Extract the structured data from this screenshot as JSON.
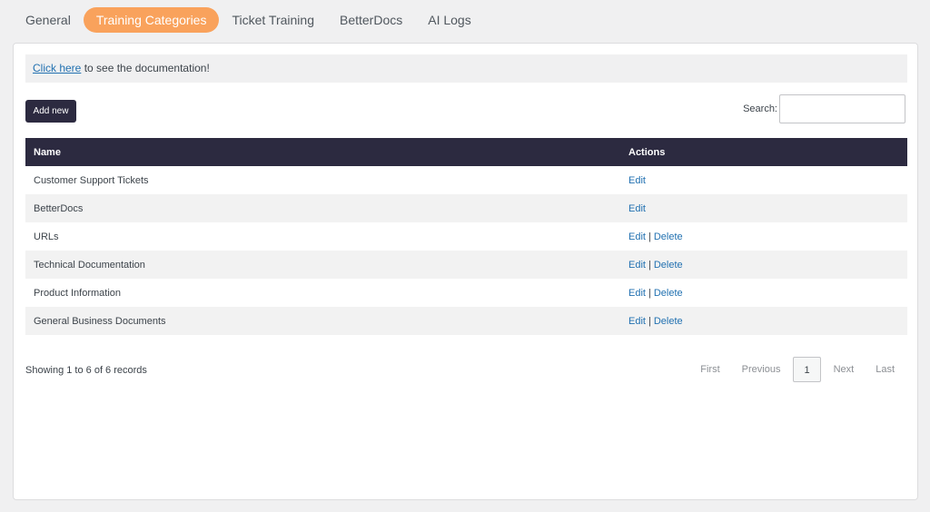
{
  "tabs": [
    {
      "label": "General",
      "active": false
    },
    {
      "label": "Training Categories",
      "active": true
    },
    {
      "label": "Ticket Training",
      "active": false
    },
    {
      "label": "BetterDocs",
      "active": false
    },
    {
      "label": "AI Logs",
      "active": false
    }
  ],
  "notice": {
    "link_text": "Click here",
    "text": " to see the documentation!"
  },
  "toolbar": {
    "add_label": "Add new",
    "search_label": "Search:",
    "search_value": "",
    "search_placeholder": ""
  },
  "table": {
    "headers": [
      "Name",
      "Actions"
    ],
    "rows": [
      {
        "name": "Customer Support Tickets",
        "actions": [
          "Edit"
        ]
      },
      {
        "name": "BetterDocs",
        "actions": [
          "Edit"
        ]
      },
      {
        "name": "URLs",
        "actions": [
          "Edit",
          "Delete"
        ]
      },
      {
        "name": "Technical Documentation",
        "actions": [
          "Edit",
          "Delete"
        ]
      },
      {
        "name": "Product Information",
        "actions": [
          "Edit",
          "Delete"
        ]
      },
      {
        "name": "General Business Documents",
        "actions": [
          "Edit",
          "Delete"
        ]
      }
    ],
    "action_separator": "|"
  },
  "footer": {
    "showing_text": "Showing 1 to 6 of 6 records",
    "pager": {
      "first": "First",
      "previous": "Previous",
      "current": "1",
      "next": "Next",
      "last": "Last"
    }
  },
  "colors": {
    "accent": "#f9a25c",
    "header_bg": "#2c2a40",
    "link": "#2271b1"
  }
}
